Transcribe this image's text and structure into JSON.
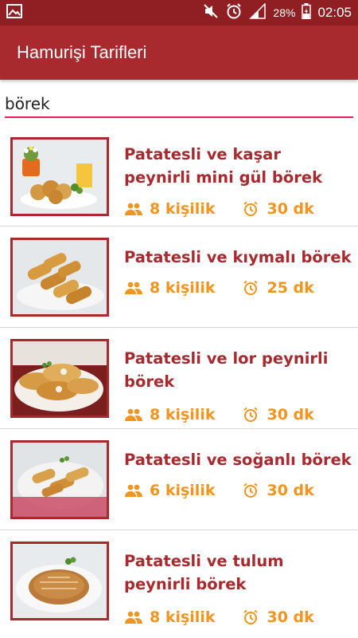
{
  "status_bar": {
    "battery": "28%",
    "time": "02:05",
    "icons": [
      "image-icon",
      "mute-icon",
      "alarm-icon",
      "signal-icon",
      "battery-icon"
    ]
  },
  "app_bar": {
    "title": "Hamurişi Tarifleri"
  },
  "search": {
    "value": "börek"
  },
  "colors": {
    "primary": "#a82a2e",
    "status": "#8f1f22",
    "accent": "#f2941e",
    "underline": "#e0245e"
  },
  "recipes": [
    {
      "title": "Patatesli ve kaşar peynirli mini gül börek",
      "servings": "8 kişilik",
      "time": "30 dk"
    },
    {
      "title": "Patatesli ve kıymalı börek",
      "servings": "8 kişilik",
      "time": "25 dk"
    },
    {
      "title": "Patatesli ve lor peynirli börek",
      "servings": "8 kişilik",
      "time": "30 dk"
    },
    {
      "title": "Patatesli ve soğanlı börek",
      "servings": "6 kişilik",
      "time": "30 dk"
    },
    {
      "title": "Patatesli ve tulum peynirli börek",
      "servings": "8 kişilik",
      "time": "30 dk"
    }
  ]
}
